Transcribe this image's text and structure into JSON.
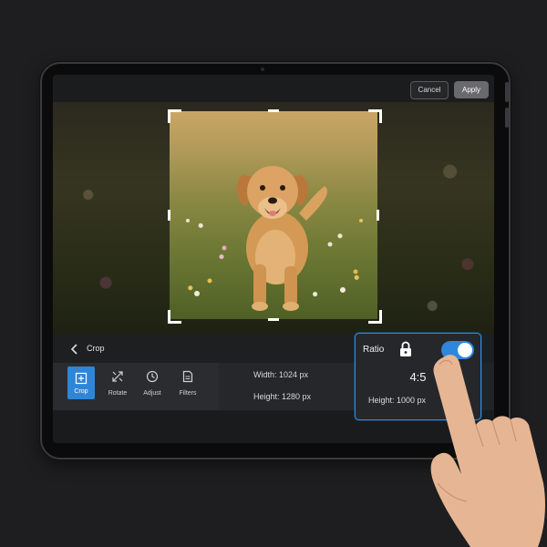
{
  "topbar": {
    "cancel_label": "Cancel",
    "apply_label": "Apply"
  },
  "panel": {
    "title": "Crop"
  },
  "tools": [
    {
      "label": "Crop",
      "icon": "crop-icon",
      "active": true
    },
    {
      "label": "Rotate",
      "icon": "rotate-icon",
      "active": false
    },
    {
      "label": "Adjust",
      "icon": "adjust-icon",
      "active": false
    },
    {
      "label": "Filters",
      "icon": "filters-icon",
      "active": false
    }
  ],
  "dimensions": {
    "width": "Width: 1024 px",
    "height": "Height: 1280 px"
  },
  "ratio_panel": {
    "title": "Ratio",
    "lock_icon": "lock-icon",
    "toggle_on": true,
    "value": "4:5",
    "height": "Height: 1000 px"
  },
  "colors": {
    "accent": "#2e86dd",
    "panel": "#25272a",
    "background": "#1e1e20"
  }
}
